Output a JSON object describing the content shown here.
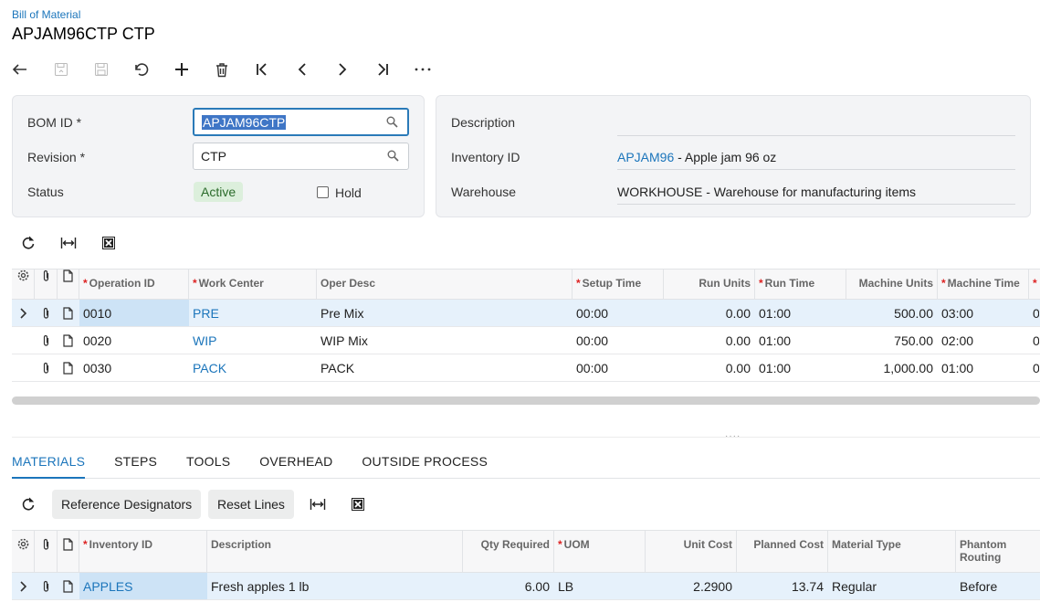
{
  "header": {
    "breadcrumb": "Bill of Material",
    "title": "APJAM96CTP CTP"
  },
  "toolbar": [
    "back-icon",
    "save-icon",
    "save-close-icon",
    "undo-icon",
    "add-icon",
    "delete-icon",
    "first-icon",
    "prev-icon",
    "next-icon",
    "last-icon",
    "more-icon"
  ],
  "form": {
    "bom_id_label": "BOM ID",
    "bom_id_value": "APJAM96CTP",
    "revision_label": "Revision",
    "revision_value": "CTP",
    "status_label": "Status",
    "status_value": "Active",
    "hold_label": "Hold",
    "description_label": "Description",
    "description_value": "",
    "inventory_label": "Inventory ID",
    "inventory_link": "APJAM96",
    "inventory_desc": " - Apple jam 96 oz",
    "warehouse_label": "Warehouse",
    "warehouse_value": "WORKHOUSE - Warehouse for manufacturing items"
  },
  "operations": {
    "headers": [
      "Operation ID",
      "Work Center",
      "Oper Desc",
      "Setup Time",
      "Run Units",
      "Run Time",
      "Machine Units",
      "Machine Time",
      ""
    ],
    "rows": [
      {
        "op": "0010",
        "wc": "PRE",
        "desc": "Pre Mix",
        "setup": "00:00",
        "run_units": "0.00",
        "run_time": "01:00",
        "mach_units": "500.00",
        "mach_time": "03:00",
        "extra": "0"
      },
      {
        "op": "0020",
        "wc": "WIP",
        "desc": "WIP Mix",
        "setup": "00:00",
        "run_units": "0.00",
        "run_time": "01:00",
        "mach_units": "750.00",
        "mach_time": "02:00",
        "extra": "0"
      },
      {
        "op": "0030",
        "wc": "PACK",
        "desc": "PACK",
        "setup": "00:00",
        "run_units": "0.00",
        "run_time": "01:00",
        "mach_units": "1,000.00",
        "mach_time": "01:00",
        "extra": "0"
      }
    ]
  },
  "tabs": [
    "MATERIALS",
    "STEPS",
    "TOOLS",
    "OVERHEAD",
    "OUTSIDE PROCESS"
  ],
  "materials_toolbar": {
    "ref_designators": "Reference Designators",
    "reset_lines": "Reset Lines"
  },
  "materials": {
    "headers": [
      "Inventory ID",
      "Description",
      "Qty Required",
      "UOM",
      "Unit Cost",
      "Planned Cost",
      "Material Type",
      "Phantom",
      "Routing"
    ],
    "rows": [
      {
        "inv": "APPLES",
        "desc": "Fresh apples 1 lb",
        "qty": "6.00",
        "uom": "LB",
        "unit_cost": "2.2900",
        "planned": "13.74",
        "type": "Regular",
        "phantom": "Before"
      }
    ]
  },
  "colors": {
    "accent": "#1b75bb",
    "active_badge": "#dcefdc"
  }
}
